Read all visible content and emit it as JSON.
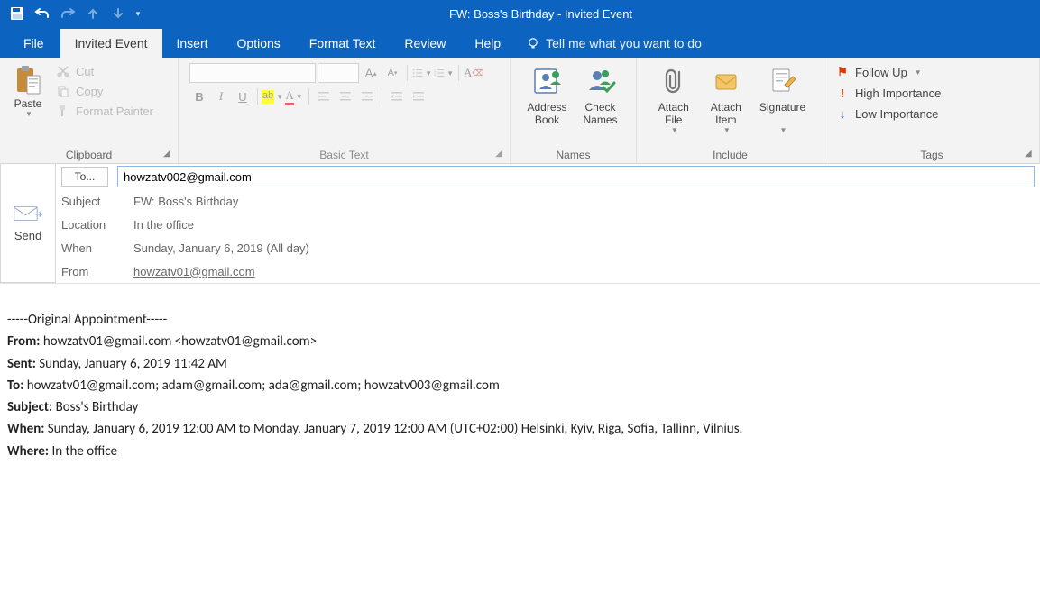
{
  "window": {
    "title": "FW: Boss's Birthday  -  Invited Event"
  },
  "tabs": {
    "file": "File",
    "invited": "Invited Event",
    "insert": "Insert",
    "options": "Options",
    "format": "Format Text",
    "review": "Review",
    "help": "Help",
    "tellme": "Tell me what you want to do"
  },
  "ribbon": {
    "clipboard": {
      "label": "Clipboard",
      "paste": "Paste",
      "cut": "Cut",
      "copy": "Copy",
      "format_painter": "Format Painter"
    },
    "basic_text": {
      "label": "Basic Text"
    },
    "names": {
      "label": "Names",
      "address_book": "Address Book",
      "check_names": "Check Names"
    },
    "include": {
      "label": "Include",
      "attach_file": "Attach File",
      "attach_item": "Attach Item",
      "signature": "Signature"
    },
    "tags": {
      "label": "Tags",
      "follow_up": "Follow Up",
      "high_importance": "High Importance",
      "low_importance": "Low Importance"
    }
  },
  "form": {
    "send": "Send",
    "to_label": "To...",
    "to_value": "howzatv002@gmail.com",
    "subject_label": "Subject",
    "subject_value": "FW: Boss's Birthday",
    "location_label": "Location",
    "location_value": "In the office",
    "when_label": "When",
    "when_value": "Sunday, January 6, 2019 (All day)",
    "from_label": "From",
    "from_value": "howzatv01@gmail.com"
  },
  "body": {
    "divider": "-----Original Appointment-----",
    "from_lbl": "From:",
    "from_val": " howzatv01@gmail.com <howzatv01@gmail.com>",
    "sent_lbl": "Sent:",
    "sent_val": " Sunday, January 6, 2019 11:42 AM",
    "to_lbl": "To:",
    "to_val": " howzatv01@gmail.com; adam@gmail.com; ada@gmail.com; howzatv003@gmail.com",
    "subject_lbl": "Subject:",
    "subject_val": " Boss's Birthday",
    "when_lbl": "When:",
    "when_val": " Sunday, January 6, 2019 12:00 AM to Monday, January 7, 2019 12:00 AM (UTC+02:00) Helsinki, Kyiv, Riga, Sofia, Tallinn, Vilnius.",
    "where_lbl": "Where:",
    "where_val": " In the office"
  }
}
